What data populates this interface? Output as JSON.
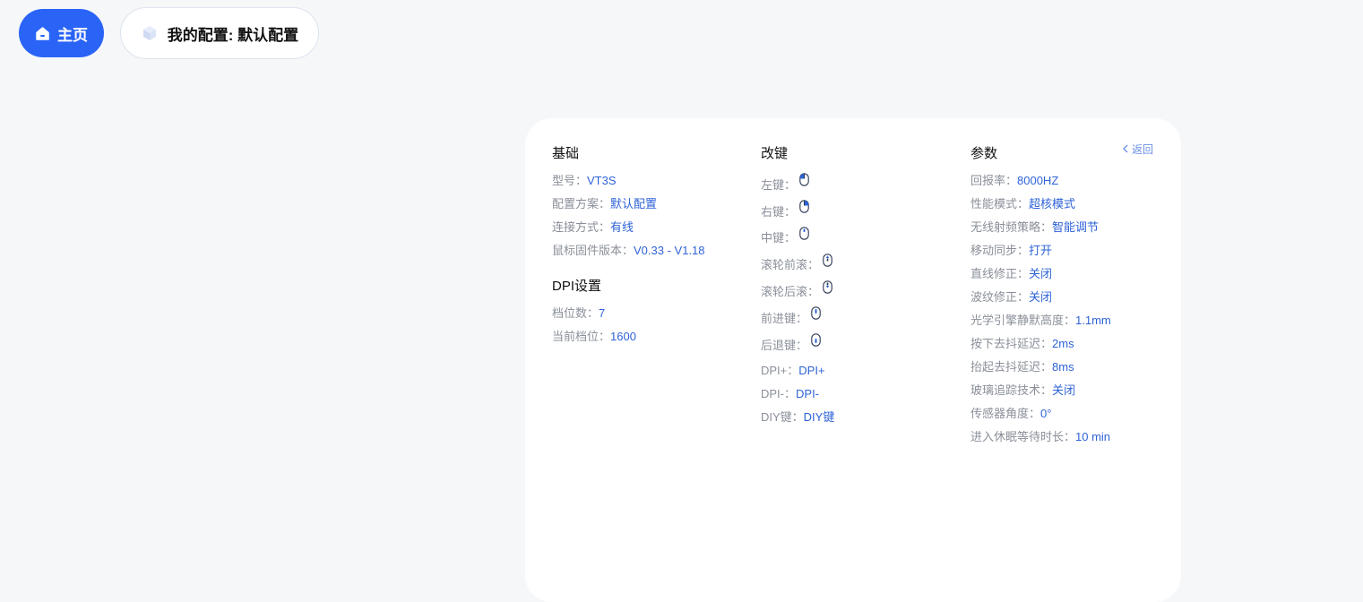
{
  "nav": {
    "home_label": "主页",
    "config_label": "我的配置: 默认配置"
  },
  "card": {
    "back_label": "返回",
    "basic": {
      "title": "基础",
      "rows": [
        {
          "label": "型号：",
          "value": "VT3S"
        },
        {
          "label": "配置方案：",
          "value": "默认配置"
        },
        {
          "label": "连接方式：",
          "value": "有线"
        },
        {
          "label": "鼠标固件版本：",
          "value": "V0.33 - V1.18"
        }
      ]
    },
    "dpi": {
      "title": "DPI设置",
      "rows": [
        {
          "label": "档位数：",
          "value": "7"
        },
        {
          "label": "当前档位：",
          "value": "1600"
        }
      ]
    },
    "keys": {
      "title": "改键",
      "icon_rows": [
        {
          "label": "左键：",
          "icon": "mouse-left-click-icon"
        },
        {
          "label": "右键：",
          "icon": "mouse-right-click-icon"
        },
        {
          "label": "中键：",
          "icon": "mouse-middle-click-icon"
        },
        {
          "label": "滚轮前滚：",
          "icon": "mouse-scroll-up-icon"
        },
        {
          "label": "滚轮后滚：",
          "icon": "mouse-scroll-down-icon"
        },
        {
          "label": "前进键：",
          "icon": "mouse-forward-icon"
        },
        {
          "label": "后退键：",
          "icon": "mouse-back-icon"
        }
      ],
      "text_rows": [
        {
          "label": "DPI+：",
          "value": "DPI+"
        },
        {
          "label": "DPI-：",
          "value": "DPI-"
        },
        {
          "label": "DIY键：",
          "value": "DIY键"
        }
      ]
    },
    "params": {
      "title": "参数",
      "rows": [
        {
          "label": "回报率：",
          "value": "8000HZ"
        },
        {
          "label": "性能模式：",
          "value": "超核模式"
        },
        {
          "label": "无线射频策略：",
          "value": "智能调节"
        },
        {
          "label": "移动同步：",
          "value": "打开"
        },
        {
          "label": "直线修正：",
          "value": "关闭"
        },
        {
          "label": "波纹修正：",
          "value": "关闭"
        },
        {
          "label": "光学引擎静默高度：",
          "value": "1.1mm"
        },
        {
          "label": "按下去抖延迟：",
          "value": "2ms"
        },
        {
          "label": "抬起去抖延迟：",
          "value": "8ms"
        },
        {
          "label": "玻璃追踪技术：",
          "value": "关闭"
        },
        {
          "label": "传感器角度：",
          "value": "0°"
        },
        {
          "label": "进入休眠等待时长：",
          "value": "10 min"
        }
      ]
    }
  },
  "colors": {
    "accent": "#2a64f6",
    "value": "#2f63d8",
    "label": "#8a8f99",
    "background": "#f6f7f9"
  }
}
